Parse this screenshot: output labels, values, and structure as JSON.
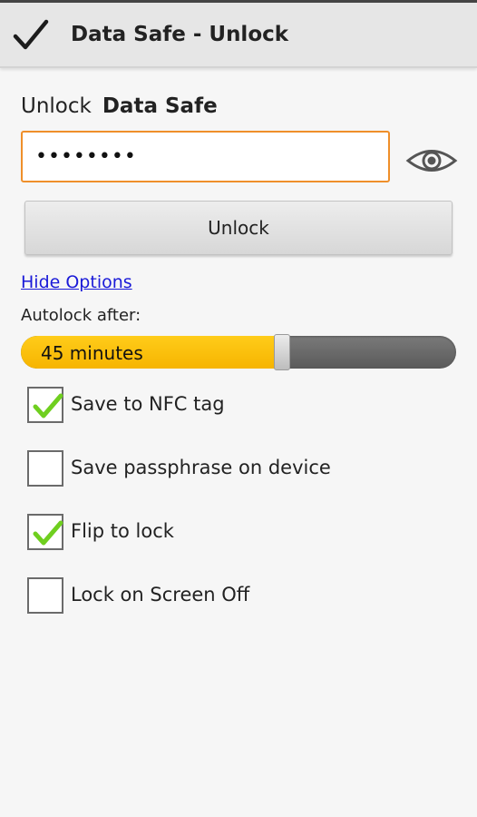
{
  "action_bar": {
    "icon": "checkmark-icon",
    "title": "Data Safe - Unlock"
  },
  "unlock_prompt": {
    "prefix": "Unlock",
    "name": "Data Safe"
  },
  "passphrase": {
    "value": "••••••••",
    "visibility_icon": "eye-icon"
  },
  "unlock_button": {
    "label": "Unlock"
  },
  "options_toggle": {
    "label": "Hide Options"
  },
  "autolock": {
    "label": "Autolock after:",
    "value_text": "45 minutes",
    "level_fraction": 0.6
  },
  "options": [
    {
      "label": "Save to NFC tag",
      "checked": true
    },
    {
      "label": "Save passphrase on device",
      "checked": false
    },
    {
      "label": "Flip to lock",
      "checked": true
    },
    {
      "label": "Lock on Screen Off",
      "checked": false
    }
  ],
  "colors": {
    "accent_orange": "#ef8f2a",
    "slider_yellow": "#f6b400",
    "link_blue": "#1a1ad8",
    "tick_green": "#6fcf1f"
  }
}
